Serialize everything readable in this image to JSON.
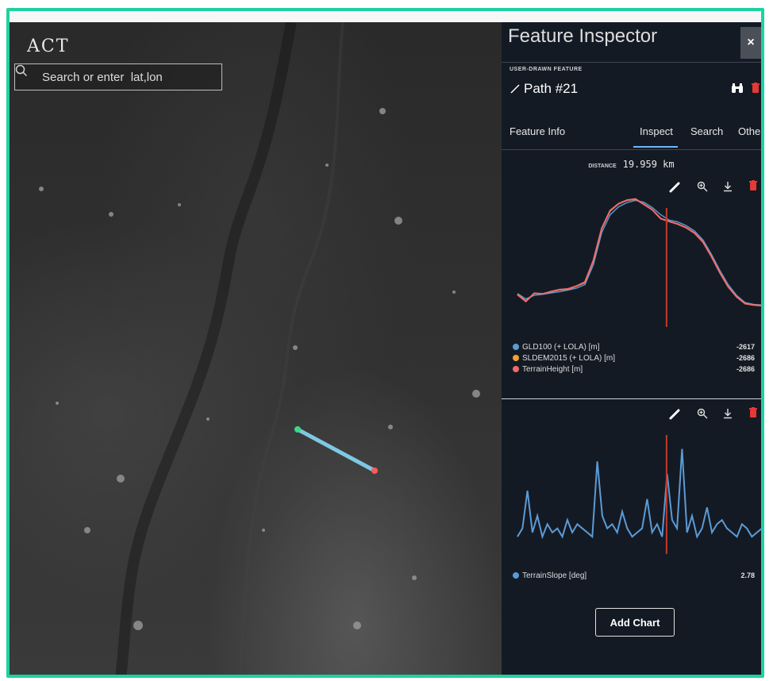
{
  "app": {
    "logo": "ACT"
  },
  "search": {
    "placeholder": "Search or enter  lat,lon"
  },
  "panel": {
    "title": "Feature Inspector",
    "close_label": "×",
    "feature_type": "USER-DRAWN FEATURE",
    "feature_name": "Path #21",
    "tabs": [
      {
        "label": "Feature Info"
      },
      {
        "label": "Inspect"
      },
      {
        "label": "Search"
      },
      {
        "label": "Other"
      }
    ],
    "distance_label": "DISTANCE",
    "distance_value": "19.959 km",
    "add_chart_label": "Add Chart"
  },
  "icons": [
    "search-icon",
    "close-icon",
    "path-icon",
    "binoculars-icon",
    "trash-icon",
    "pencil-icon",
    "zoom-icon",
    "download-icon"
  ],
  "colors": {
    "accent_frame": "#1fd1a1",
    "tab_underline": "#6cb6ff",
    "series_blue": "#5b9bd5",
    "series_orange": "#f0a030",
    "series_red": "#ef6b6b",
    "cursor_red": "#c0392b",
    "trash_red": "#e53935"
  },
  "chart_data": [
    {
      "type": "line",
      "ylim": [
        -5500,
        -2000
      ],
      "series": [
        {
          "name": "GLD100 (+ LOLA) [m]",
          "color": "#5b9bd5",
          "current": "-2617",
          "values": [
            -4700,
            -4850,
            -4750,
            -4720,
            -4680,
            -4650,
            -4600,
            -4550,
            -4450,
            -3900,
            -3000,
            -2500,
            -2280,
            -2160,
            -2100,
            -2150,
            -2300,
            -2500,
            -2650,
            -2700,
            -2800,
            -2950,
            -3200,
            -3600,
            -4050,
            -4450,
            -4750,
            -4950,
            -5000,
            -5020
          ]
        },
        {
          "name": "SLDEM2015 (+ LOLA) [m]",
          "color": "#f0a030",
          "current": "-2686",
          "values": [
            -4720,
            -4900,
            -4700,
            -4700,
            -4650,
            -4600,
            -4580,
            -4500,
            -4400,
            -3800,
            -2900,
            -2400,
            -2200,
            -2100,
            -2070,
            -2200,
            -2350,
            -2600,
            -2686,
            -2750,
            -2850,
            -3000,
            -3250,
            -3650,
            -4100,
            -4500,
            -4780,
            -4970,
            -5010,
            -5030
          ]
        },
        {
          "name": "TerrainHeight [m]",
          "color": "#ef6b6b",
          "current": "-2686",
          "values": [
            -4730,
            -4920,
            -4690,
            -4710,
            -4640,
            -4590,
            -4570,
            -4490,
            -4380,
            -3780,
            -2880,
            -2380,
            -2190,
            -2090,
            -2060,
            -2210,
            -2360,
            -2610,
            -2686,
            -2760,
            -2860,
            -3010,
            -3260,
            -3660,
            -4110,
            -4510,
            -4790,
            -4980,
            -5020,
            -5040
          ]
        }
      ]
    },
    {
      "type": "line",
      "ylim": [
        0,
        30
      ],
      "series": [
        {
          "name": "TerrainSlope [deg]",
          "color": "#5b9bd5",
          "current": "2.78",
          "values": [
            3,
            5,
            14,
            4,
            8,
            3,
            6,
            4,
            5,
            3,
            7,
            4,
            6,
            5,
            4,
            3,
            21,
            8,
            5,
            6,
            4,
            9,
            5,
            3,
            4,
            5,
            12,
            4,
            6,
            3,
            18,
            7,
            5,
            24,
            4,
            8,
            3,
            5,
            10,
            4,
            6,
            7,
            5,
            4,
            3,
            6,
            5,
            3,
            4,
            5
          ]
        }
      ]
    }
  ]
}
